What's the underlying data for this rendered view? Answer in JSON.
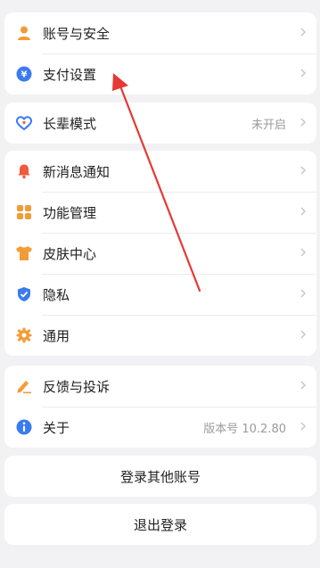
{
  "colors": {
    "accent_blue": "#3b7bf0",
    "accent_orange": "#f29c38",
    "accent_red": "#f05a3c",
    "annotation_red": "#e53935"
  },
  "group1": [
    {
      "label": "账号与安全",
      "icon": "user-icon"
    },
    {
      "label": "支付设置",
      "icon": "yen-icon"
    }
  ],
  "group2": [
    {
      "label": "长辈模式",
      "value": "未开启",
      "icon": "heart-icon"
    }
  ],
  "group3": [
    {
      "label": "新消息通知",
      "icon": "bell-icon"
    },
    {
      "label": "功能管理",
      "icon": "grid-icon"
    },
    {
      "label": "皮肤中心",
      "icon": "shirt-icon"
    },
    {
      "label": "隐私",
      "icon": "shield-icon"
    },
    {
      "label": "通用",
      "icon": "gear-icon"
    }
  ],
  "group4": [
    {
      "label": "反馈与投诉",
      "icon": "pen-icon"
    },
    {
      "label": "关于",
      "value": "版本号 10.2.80",
      "icon": "info-icon"
    }
  ],
  "actions": {
    "switch_account": "登录其他账号",
    "logout": "退出登录"
  }
}
